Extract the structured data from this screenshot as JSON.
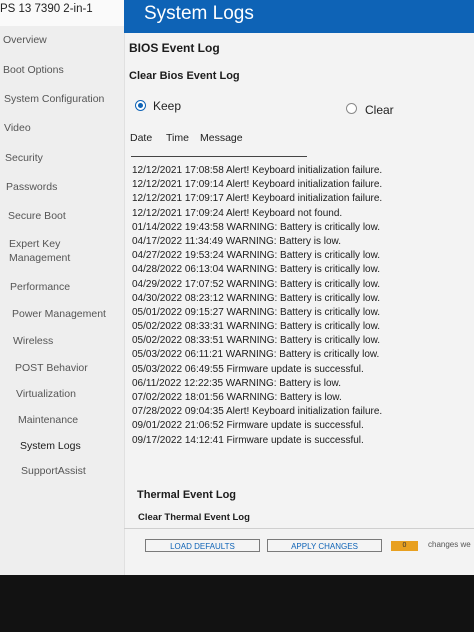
{
  "device_title": "PS 13 7390 2-in-1",
  "sidebar": {
    "items": [
      {
        "label": "Overview"
      },
      {
        "label": "Boot Options"
      },
      {
        "label": "System Configuration"
      },
      {
        "label": "Video"
      },
      {
        "label": "Security"
      },
      {
        "label": "Passwords"
      },
      {
        "label": "Secure Boot"
      },
      {
        "label": "Expert Key"
      },
      {
        "label": "Management"
      },
      {
        "label": "Performance"
      },
      {
        "label": "Power Management"
      },
      {
        "label": "Wireless"
      },
      {
        "label": "POST Behavior"
      },
      {
        "label": "Virtualization"
      },
      {
        "label": "Maintenance"
      },
      {
        "label": "System Logs"
      },
      {
        "label": "SupportAssist"
      }
    ]
  },
  "header": {
    "title": "System Logs"
  },
  "bios_log": {
    "title": "BIOS Event Log",
    "clear_label": "Clear Bios Event Log",
    "keep_label": "Keep",
    "clear_option_label": "Clear",
    "selected": "Keep",
    "columns": [
      "Date",
      "Time",
      "Message"
    ],
    "entries": [
      "12/12/2021 17:08:58 Alert! Keyboard initialization failure.",
      "12/12/2021 17:09:14 Alert! Keyboard initialization failure.",
      "12/12/2021 17:09:17 Alert! Keyboard initialization failure.",
      "12/12/2021 17:09:24 Alert! Keyboard not found.",
      "01/14/2022 19:43:58 WARNING: Battery is critically low.",
      "04/17/2022 11:34:49 WARNING: Battery is low.",
      "04/27/2022 19:53:24 WARNING: Battery is critically low.",
      "04/28/2022 06:13:04 WARNING: Battery is critically low.",
      "04/29/2022 17:07:52 WARNING: Battery is critically low.",
      "04/30/2022 08:23:12 WARNING: Battery is critically low.",
      "05/01/2022 09:15:27 WARNING: Battery is critically low.",
      "05/02/2022 08:33:31 WARNING: Battery is critically low.",
      "05/02/2022 08:33:51 WARNING: Battery is critically low.",
      "05/03/2022 06:11:21 WARNING: Battery is critically low.",
      "05/03/2022 06:49:55 Firmware update is successful.",
      "06/11/2022 12:22:35 WARNING: Battery is low.",
      "07/02/2022 18:01:56 WARNING: Battery is low.",
      "07/28/2022 09:04:35 Alert! Keyboard initialization failure.",
      "09/01/2022 21:06:52 Firmware update is successful.",
      "09/17/2022 14:12:41 Firmware update is successful."
    ]
  },
  "thermal_log": {
    "title": "Thermal Event Log",
    "clear_label": "Clear Thermal Event Log"
  },
  "footer": {
    "load_defaults": "LOAD DEFAULTS",
    "apply_changes": "APPLY CHANGES",
    "changes_count": "0",
    "changes_label": "changes we"
  },
  "colors": {
    "header_blue": "#0e63b6",
    "counter_orange": "#e8a020"
  }
}
